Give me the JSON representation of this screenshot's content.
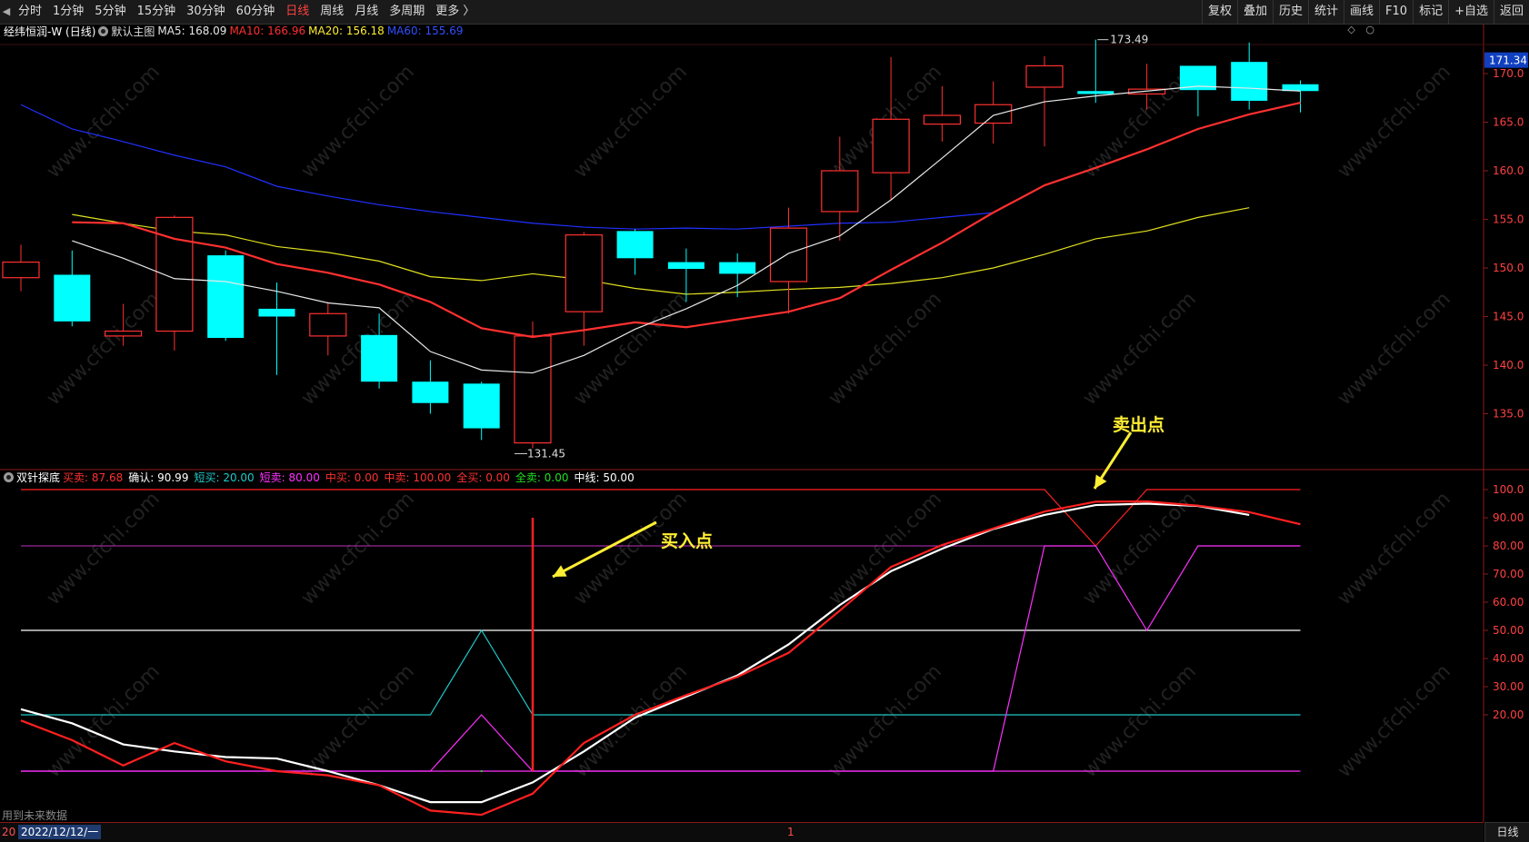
{
  "toolbar": {
    "periods": [
      "分时",
      "1分钟",
      "5分钟",
      "15分钟",
      "30分钟",
      "60分钟",
      "日线",
      "周线",
      "月线",
      "多周期",
      "更多 〉"
    ],
    "active_period": "日线",
    "right_buttons": [
      "复权",
      "叠加",
      "历史",
      "统计",
      "画线",
      "F10",
      "标记",
      "+自选",
      "返回"
    ]
  },
  "main_panel": {
    "title": "经纬恒润-W (日线)",
    "template": "默认主图",
    "indicators": [
      {
        "label": "MA5: 168.09",
        "color": "#e8e8e8"
      },
      {
        "label": "MA10: 166.96",
        "color": "#ff3030"
      },
      {
        "label": "MA20: 156.18",
        "color": "#ffee33"
      },
      {
        "label": "MA60: 155.69",
        "color": "#3050ff"
      }
    ],
    "last_price": "171.34",
    "high_label": "173.49",
    "low_label": "131.45",
    "y_ticks": [
      "170.0",
      "165.0",
      "160.0",
      "155.0",
      "150.0",
      "145.0",
      "140.0",
      "135.0"
    ]
  },
  "sub_panel": {
    "title": "双针探底",
    "indicators": [
      {
        "label": "买卖:",
        "value": "87.68",
        "color": "#ff3030"
      },
      {
        "label": "确认:",
        "value": "90.99",
        "color": "#ffffff"
      },
      {
        "label": "短买:",
        "value": "20.00",
        "color": "#20c8c8"
      },
      {
        "label": "短卖:",
        "value": "80.00",
        "color": "#ff30ff"
      },
      {
        "label": "中买:",
        "value": "0.00",
        "color": "#ff3030"
      },
      {
        "label": "中卖:",
        "value": "100.00",
        "color": "#ff3030"
      },
      {
        "label": "全买:",
        "value": "0.00",
        "color": "#ff3030"
      },
      {
        "label": "全卖:",
        "value": "0.00",
        "color": "#20e020"
      },
      {
        "label": "中线:",
        "value": "50.00",
        "color": "#ffffff"
      }
    ],
    "y_ticks": [
      "100.0",
      "90.00",
      "80.00",
      "70.00",
      "60.00",
      "50.00",
      "40.00",
      "30.00",
      "20.00"
    ],
    "annotations": {
      "buy": "买入点",
      "sell": "卖出点"
    }
  },
  "footer": {
    "future_note": "用到未来数据",
    "date_prefix": "20",
    "date": "2022/12/12/一",
    "mid_marker": "1",
    "period_tab": "日线"
  },
  "watermark": "www.cfchi.com",
  "colors": {
    "up": "#ff3030",
    "down": "#00ffff",
    "ma5": "#e8e8e8",
    "ma10": "#ff3030",
    "ma20": "#e0e020",
    "ma60": "#2030ff"
  },
  "chart_data": {
    "type": "candlestick",
    "price_range": [
      131,
      174
    ],
    "candles": [
      {
        "o": 149.0,
        "c": 150.6,
        "h": 152.4,
        "l": 147.6
      },
      {
        "o": 149.3,
        "c": 144.5,
        "h": 151.8,
        "l": 144.0
      },
      {
        "o": 143.0,
        "c": 143.5,
        "h": 146.3,
        "l": 142.0
      },
      {
        "o": 143.5,
        "c": 155.2,
        "h": 155.4,
        "l": 141.5
      },
      {
        "o": 151.3,
        "c": 142.8,
        "h": 151.8,
        "l": 142.5
      },
      {
        "o": 145.8,
        "c": 145.0,
        "h": 148.5,
        "l": 139.0
      },
      {
        "o": 143.0,
        "c": 145.3,
        "h": 146.5,
        "l": 141.0
      },
      {
        "o": 143.1,
        "c": 138.3,
        "h": 145.3,
        "l": 137.6
      },
      {
        "o": 138.3,
        "c": 136.1,
        "h": 140.5,
        "l": 135.0
      },
      {
        "o": 138.1,
        "c": 133.5,
        "h": 138.3,
        "l": 132.3
      },
      {
        "o": 132.0,
        "c": 143.0,
        "h": 144.5,
        "l": 131.45
      },
      {
        "o": 145.5,
        "c": 153.4,
        "h": 153.7,
        "l": 142.0
      },
      {
        "o": 153.8,
        "c": 151.0,
        "h": 154.0,
        "l": 149.3
      },
      {
        "o": 150.6,
        "c": 149.9,
        "h": 152.0,
        "l": 146.5
      },
      {
        "o": 150.6,
        "c": 149.4,
        "h": 151.5,
        "l": 147.0
      },
      {
        "o": 148.6,
        "c": 154.1,
        "h": 156.2,
        "l": 145.3
      },
      {
        "o": 155.8,
        "c": 160.0,
        "h": 163.5,
        "l": 152.8
      },
      {
        "o": 159.8,
        "c": 165.3,
        "h": 171.7,
        "l": 157.0
      },
      {
        "o": 164.8,
        "c": 165.7,
        "h": 168.7,
        "l": 163.0
      },
      {
        "o": 164.9,
        "c": 166.8,
        "h": 169.2,
        "l": 162.8
      },
      {
        "o": 168.6,
        "c": 170.8,
        "h": 171.8,
        "l": 162.5
      },
      {
        "o": 168.2,
        "c": 167.9,
        "h": 173.49,
        "l": 167.0
      },
      {
        "o": 167.9,
        "c": 168.4,
        "h": 171.0,
        "l": 166.3
      },
      {
        "o": 170.8,
        "c": 168.3,
        "h": 170.8,
        "l": 165.6
      },
      {
        "o": 171.2,
        "c": 167.2,
        "h": 173.2,
        "l": 166.3
      },
      {
        "o": 168.9,
        "c": 168.2,
        "h": 169.3,
        "l": 166.0
      }
    ],
    "ma5": [
      152.8,
      151.0,
      148.9,
      148.6,
      147.6,
      146.4,
      145.9,
      141.4,
      139.5,
      139.2,
      141.0,
      143.7,
      145.8,
      148.2,
      151.5,
      153.3,
      157.0,
      161.3,
      165.7,
      167.1,
      167.7,
      168.2,
      168.7,
      168.5,
      168.2
    ],
    "ma10": [
      154.7,
      154.6,
      153.0,
      152.1,
      150.4,
      149.5,
      148.3,
      146.5,
      143.8,
      142.9,
      143.6,
      144.4,
      143.9,
      144.7,
      145.5,
      146.9,
      149.8,
      152.6,
      155.7,
      158.5,
      160.3,
      162.2,
      164.3,
      165.8,
      167.0
    ],
    "ma20": [
      155.5,
      154.6,
      153.8,
      153.4,
      152.2,
      151.6,
      150.7,
      149.1,
      148.7,
      149.4,
      148.8,
      147.9,
      147.3,
      147.5,
      147.8,
      148.0,
      148.4,
      149.0,
      150.0,
      151.4,
      153.0,
      153.8,
      155.2,
      156.2
    ],
    "ma60": [
      166.8,
      164.3,
      163.0,
      161.6,
      160.4,
      158.4,
      157.4,
      156.5,
      155.8,
      155.2,
      154.6,
      154.2,
      154.0,
      154.1,
      154.0,
      154.3,
      154.6,
      154.7,
      155.2,
      155.69
    ],
    "sub": {
      "range": [
        0,
        105
      ],
      "buysell": [
        18.0,
        11.0,
        2.0,
        10.0,
        3.5,
        0.0,
        -1.5,
        -5.0,
        -14.0,
        -15.5,
        -8.0,
        10.0,
        20.0,
        27.0,
        33.5,
        42.0,
        57.0,
        72.5,
        80.3,
        86.2,
        92.2,
        95.7,
        95.8,
        94.3,
        92.0,
        87.68
      ],
      "confirm": [
        22.0,
        17.0,
        9.5,
        7.0,
        5.0,
        4.5,
        0.0,
        -5.0,
        -11.0,
        -11.0,
        -4.0,
        7.0,
        19.0,
        26.5,
        34.0,
        45.0,
        59.0,
        71.0,
        79.0,
        86.0,
        91.0,
        94.5,
        95.0,
        94.2,
        90.99
      ],
      "short_buy": [
        20,
        20,
        20,
        20,
        20,
        20,
        20,
        20,
        20,
        50,
        20,
        20,
        20,
        20,
        20,
        20,
        20,
        20,
        20,
        20,
        20,
        20,
        20,
        20,
        20,
        20
      ],
      "short_sell": [
        0,
        0,
        0,
        0,
        0,
        0,
        0,
        0,
        0,
        20,
        0,
        0,
        0,
        0,
        0,
        0,
        0,
        0,
        0,
        0,
        80,
        80,
        50,
        80,
        80,
        80
      ],
      "mid_sell": [
        100,
        100,
        100,
        100,
        100,
        100,
        100,
        100,
        100,
        100,
        100,
        100,
        100,
        100,
        100,
        100,
        100,
        100,
        100,
        100,
        100,
        80,
        100,
        100,
        100,
        100
      ],
      "midline": 50,
      "signal_value": 90
    }
  }
}
